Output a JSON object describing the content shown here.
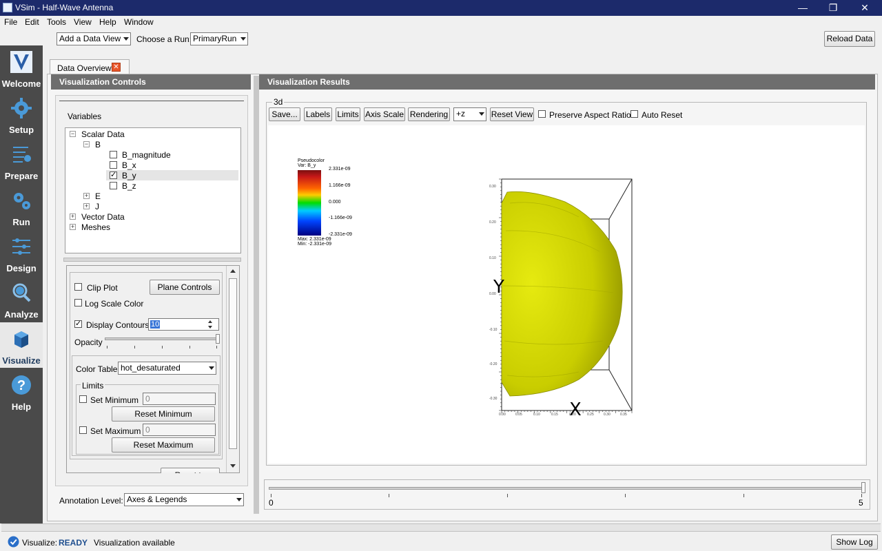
{
  "window": {
    "title": "VSim - Half-Wave Antenna",
    "minimize": "—",
    "maximize": "❐",
    "close": "✕"
  },
  "menu": [
    "File",
    "Edit",
    "Tools",
    "View",
    "Help",
    "Window"
  ],
  "rail": [
    {
      "label": "Welcome",
      "icon": "vsim-logo-icon"
    },
    {
      "label": "Setup",
      "icon": "gear-icon"
    },
    {
      "label": "Prepare",
      "icon": "prepare-icon"
    },
    {
      "label": "Run",
      "icon": "gears-icon"
    },
    {
      "label": "Design",
      "icon": "sliders-icon"
    },
    {
      "label": "Analyze",
      "icon": "magnifier-icon"
    },
    {
      "label": "Visualize",
      "icon": "cube-icon"
    },
    {
      "label": "Help",
      "icon": "help-icon"
    }
  ],
  "top": {
    "data_view": "Add a Data View",
    "choose_run_label": "Choose a Run:",
    "run": "PrimaryRun",
    "reload": "Reload Data"
  },
  "tab": {
    "label": "Data Overview"
  },
  "controls": {
    "header": "Visualization Controls",
    "variables_title": "Variables",
    "tree": {
      "scalar": "Scalar Data",
      "b": "B",
      "b_magnitude": "B_magnitude",
      "b_x": "B_x",
      "b_y": "B_y",
      "b_z": "B_z",
      "e": "E",
      "j": "J",
      "vector": "Vector Data",
      "meshes": "Meshes"
    },
    "clip_plot": "Clip Plot",
    "plane_controls": "Plane Controls",
    "log_scale": "Log Scale Color",
    "display_contours": "Display Contours",
    "contours_value": "10",
    "opacity": "Opacity",
    "color_table_label": "Color Table",
    "color_table": "hot_desaturated",
    "limits": "Limits",
    "set_minimum": "Set Minimum",
    "min_value": "0",
    "reset_minimum": "Reset Minimum",
    "set_maximum": "Set Maximum",
    "max_value": "0",
    "reset_maximum": "Reset Maximum",
    "reset_defaults": "Reset to Defaults",
    "annotation_label": "Annotation Level:",
    "annotation": "Axes & Legends"
  },
  "results": {
    "header": "Visualization Results",
    "group": "3d",
    "save": "Save...",
    "labels": "Labels",
    "limits": "Limits",
    "axis_scale": "Axis Scale",
    "rendering": "Rendering",
    "view_dir": "+z",
    "reset_view": "Reset View",
    "preserve_aspect": "Preserve Aspect Ratio",
    "auto_reset": "Auto Reset",
    "legend_title": "Pseudocolor",
    "legend_var": "Var: B_y",
    "legend_ticks": [
      "2.331e-09",
      "1.166e-09",
      "0.000",
      "-1.166e-09",
      "-2.331e-09"
    ],
    "legend_max": "Max: 2.331e-09",
    "legend_min": "Min: -2.331e-09",
    "axis_x": "X",
    "axis_y": "Y",
    "y_ticks": [
      "0.30",
      "0.20",
      "0.10",
      "0.00",
      "-0.10",
      "-0.20",
      "-0.30"
    ],
    "x_ticks": [
      "0.00",
      "0.05",
      "0.10",
      "0.15",
      "0.20",
      "0.25",
      "0.30",
      "0.35"
    ],
    "slider_min": "0",
    "slider_max": "5"
  },
  "status": {
    "label": "Visualize:",
    "state": "READY",
    "message": "Visualization available",
    "show_log": "Show Log"
  }
}
